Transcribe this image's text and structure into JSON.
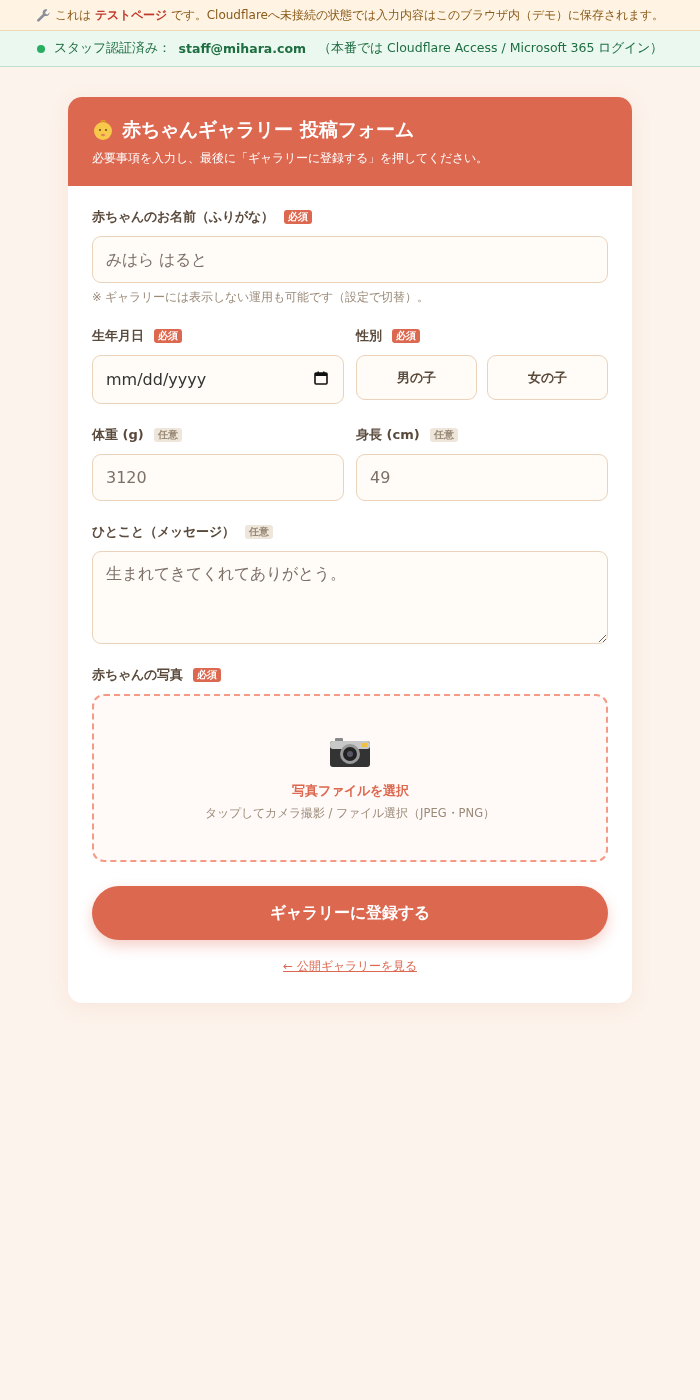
{
  "test_banner": {
    "text": "これは **テストページ** です。Cloudflareへ未接続の状態では入力内容はこのブラウザ内（デモ）に保存されます。"
  },
  "auth_bar": {
    "label": "スタッフ認証済み：",
    "email": "staff@mihara.com",
    "note": "（本番では Cloudflare Access / Microsoft 365 ログイン）"
  },
  "form": {
    "title": "赤ちゃんギャラリー 投稿フォーム",
    "subtitle": "必要事項を入力し、最後に「ギャラリーに登録する」を押してください。",
    "rows": [
      [
        {
          "kind": "text",
          "label": "赤ちゃんのお名前（ふりがな）",
          "badge": {
            "kind": "required",
            "text": "必須"
          },
          "placeholder": "みはら はると",
          "hint": "※ ギャラリーには表示しない運用も可能です（設定で切替）。"
        }
      ],
      [
        {
          "kind": "date",
          "label": "生年月日",
          "badge": {
            "kind": "required",
            "text": "必須"
          },
          "placeholder": "mm/dd/yyyy"
        },
        {
          "kind": "choice",
          "label": "性別",
          "badge": {
            "kind": "required",
            "text": "必須"
          },
          "options": [
            {
              "label": "男の子",
              "selected": false
            },
            {
              "label": "女の子",
              "selected": false
            }
          ]
        }
      ],
      [
        {
          "kind": "text",
          "label": "体重 (g)",
          "badge": {
            "kind": "optional",
            "text": "任意"
          },
          "placeholder": "3120"
        },
        {
          "kind": "text",
          "label": "身長 (cm)",
          "badge": {
            "kind": "optional",
            "text": "任意"
          },
          "placeholder": "49"
        }
      ],
      [
        {
          "kind": "textarea",
          "label": "ひとこと（メッセージ）",
          "badge": {
            "kind": "optional",
            "text": "任意"
          },
          "placeholder": "生まれてきてくれてありがとう。"
        }
      ],
      [
        {
          "kind": "upload",
          "label": "赤ちゃんの写真",
          "badge": {
            "kind": "required",
            "text": "必須"
          },
          "action": "写真ファイルを選択",
          "hint": "タップしてカメラ撮影 / ファイル選択（JPEG・PNG）"
        }
      ]
    ],
    "submit": "ギャラリーに登録する",
    "back_link": "← 公開ギャラリーを見る"
  }
}
